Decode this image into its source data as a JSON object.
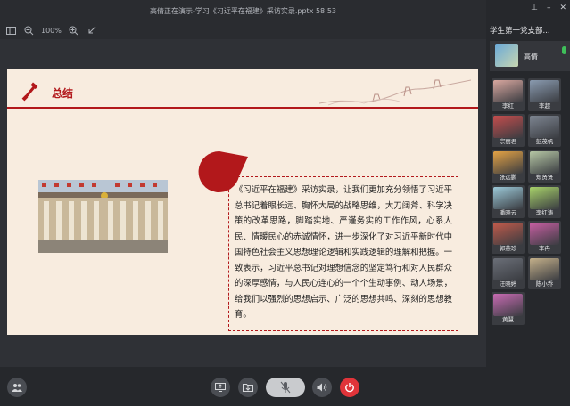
{
  "window": {
    "title": "高倩正在演示-学习《习近平在福建》采访实录.pptx 58:53"
  },
  "toolbar": {
    "zoom": "100%"
  },
  "right_panel": {
    "group_title": "学生第一党支部...",
    "host": {
      "name": "高倩"
    },
    "participants": [
      {
        "name": "李红",
        "color": "#d9a8a0"
      },
      {
        "name": "李超",
        "color": "#8a9bb0"
      },
      {
        "name": "宗丽君",
        "color": "#c44d4d"
      },
      {
        "name": "彭茂帆",
        "color": "#7d8591"
      },
      {
        "name": "张远鹏",
        "color": "#e4a345"
      },
      {
        "name": "郑贤贤",
        "color": "#b6c7a5"
      },
      {
        "name": "潘晓云",
        "color": "#9cc9d8"
      },
      {
        "name": "李红涛",
        "color": "#a8d26a"
      },
      {
        "name": "郭燕珍",
        "color": "#c25b4b"
      },
      {
        "name": "李冉",
        "color": "#c85fa3"
      },
      {
        "name": "汪晓婷",
        "color": "#6b6f78"
      },
      {
        "name": "陈小乔",
        "color": "#c4b08a"
      },
      {
        "name": "黄慧",
        "color": "#c86bb3"
      }
    ]
  },
  "slide": {
    "title": "总结",
    "body": "《习近平在福建》采访实录，让我们更加充分领悟了习近平总书记着眼长远、胸怀大局的战略思维，大刀阔斧、科学决策的改革思路，脚踏实地、严谨务实的工作作风，心系人民、情暖民心的赤诚情怀，进一步深化了对习近平新时代中国特色社会主义思想理论逻辑和实践逻辑的理解和把握。一致表示，习近平总书记对理想信念的坚定笃行和对人民群众的深厚感情，与人民心连心的一个个生动事例、动人场景，给我们以强烈的思想启示、广泛的思想共鸣、深刻的思想教育。"
  },
  "colors": {
    "accent_red": "#b2181b",
    "slide_bg": "#f8ecdf",
    "end_call": "#e0343a"
  }
}
